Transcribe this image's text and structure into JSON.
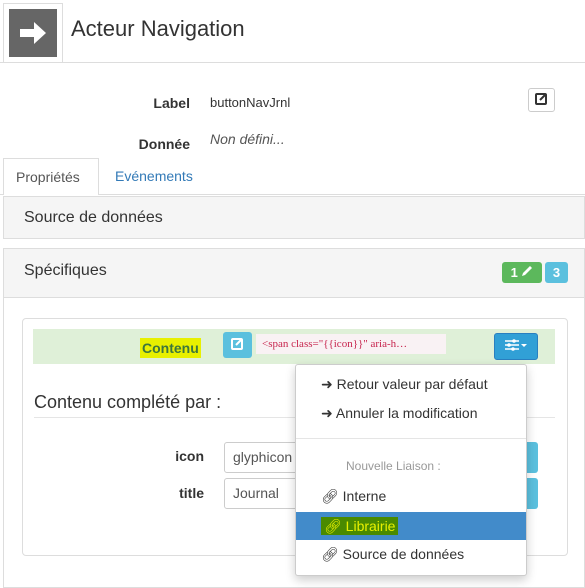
{
  "header": {
    "title": "Acteur Navigation",
    "icon": "arrow-right-icon"
  },
  "fields": {
    "label_name": "Label",
    "label_value": "buttonNavJrnl",
    "donnee_name": "Donnée",
    "donnee_value": "Non défini..."
  },
  "tabs": [
    {
      "label": "Propriétés",
      "active": true
    },
    {
      "label": "Evénements",
      "active": false
    }
  ],
  "panels": {
    "source": "Source de données",
    "specifiques": "Spécifiques",
    "badge_modified": "1",
    "badge_count": "3"
  },
  "contenu": {
    "label": "Contenu",
    "value": "<span class=\"{{icon}}\" aria-h…",
    "completed_by": "Contenu complété par :"
  },
  "params": [
    {
      "name": "icon",
      "value": "glyphicon"
    },
    {
      "name": "title",
      "value": "Journal"
    }
  ],
  "menu": {
    "items": [
      "Retour valeur par défaut",
      "Annuler la modification"
    ],
    "header": "Nouvelle Liaison :",
    "links": [
      "Interne",
      "Librairie",
      "Source de données"
    ],
    "active": "Librairie"
  },
  "colors": {
    "success": "#5cb85c",
    "info": "#5bc0de",
    "primary": "#428bca",
    "highlight": "#e8f000",
    "row_bg": "#dff0d8"
  }
}
